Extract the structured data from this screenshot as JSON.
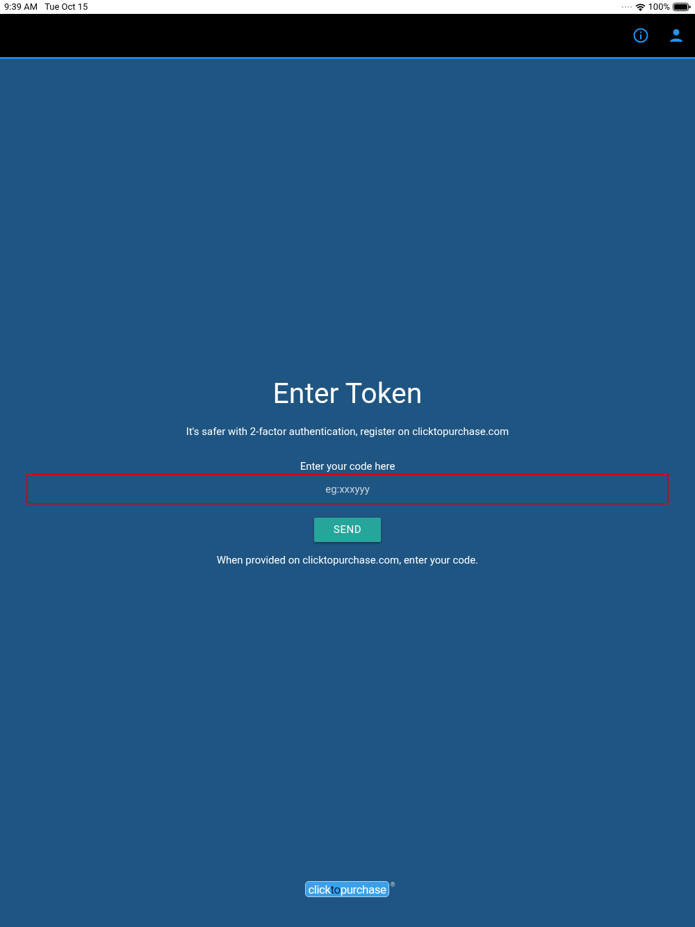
{
  "status_bar": {
    "time": "9:39 AM",
    "date": "Tue Oct 15",
    "battery": "100%"
  },
  "title": "Enter Token",
  "subtitle": "It's safer with 2-factor authentication, register on clicktopurchase.com",
  "field": {
    "label": "Enter your code here",
    "placeholder": "eg:xxxyyy",
    "invalid": true
  },
  "send_button": "SEND",
  "hint": "When provided on clicktopurchase.com, enter your code.",
  "logo": {
    "parts": [
      "click",
      "to",
      "purchase"
    ],
    "mark": "®"
  }
}
